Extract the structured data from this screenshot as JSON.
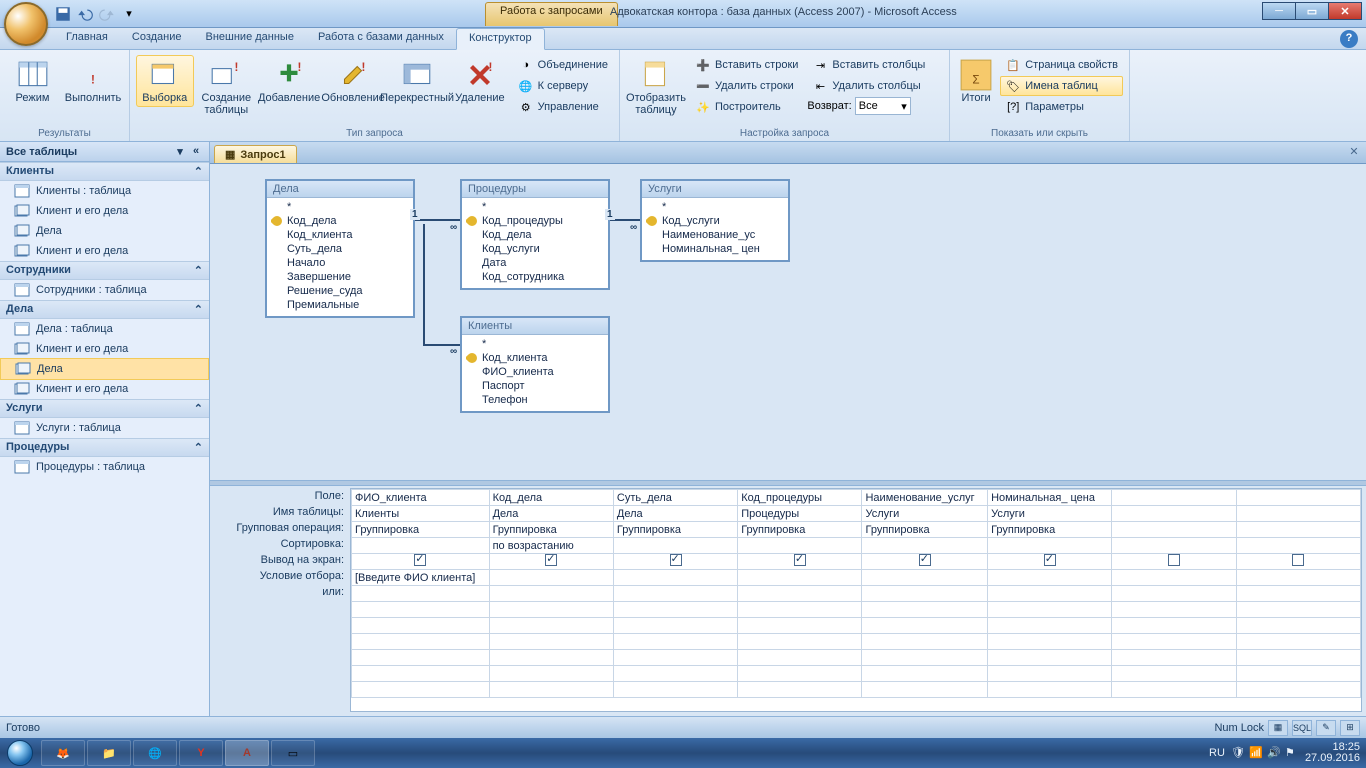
{
  "title": {
    "context": "Работа с запросами",
    "main": "Адвокатская контора : база данных (Access 2007) - Microsoft Access"
  },
  "tabs": {
    "t1": "Главная",
    "t2": "Создание",
    "t3": "Внешние данные",
    "t4": "Работа с базами данных",
    "t5": "Конструктор"
  },
  "ribbon": {
    "g1": "Результаты",
    "g2": "Тип запроса",
    "g3": "Настройка запроса",
    "g4": "Показать или скрыть",
    "rezhim": "Режим",
    "vypolnit": "Выполнить",
    "vyborka": "Выборка",
    "sozdanie": "Создание\nтаблицы",
    "dobavlenie": "Добавление",
    "obnovlenie": "Обновление",
    "perekrest": "Перекрестный",
    "udalenie": "Удаление",
    "obed": "Объединение",
    "kserv": "К серверу",
    "uprav": "Управление",
    "otobrazit": "Отобразить\nтаблицу",
    "vststr": "Вставить строки",
    "udstr": "Удалить строки",
    "postroit": "Построитель",
    "vststol": "Вставить столбцы",
    "udstol": "Удалить столбцы",
    "vozvrat": "Возврат:",
    "vozvratval": "Все",
    "itogi": "Итоги",
    "strsvo": "Страница свойств",
    "imtab": "Имена таблиц",
    "param": "Параметры"
  },
  "nav": {
    "header": "Все таблицы",
    "groups": [
      {
        "title": "Клиенты",
        "items": [
          "Клиенты : таблица",
          "Клиент и его дела",
          "Дела",
          "Клиент и его дела"
        ]
      },
      {
        "title": "Сотрудники",
        "items": [
          "Сотрудники : таблица"
        ]
      },
      {
        "title": "Дела",
        "items": [
          "Дела : таблица",
          "Клиент и его дела",
          "Дела",
          "Клиент и его дела"
        ],
        "selected": 2
      },
      {
        "title": "Услуги",
        "items": [
          "Услуги : таблица"
        ]
      },
      {
        "title": "Процедуры",
        "items": [
          "Процедуры : таблица"
        ]
      }
    ]
  },
  "doc": {
    "tab": "Запрос1"
  },
  "tables": {
    "dela": {
      "title": "Дела",
      "fields": [
        "*",
        "Код_дела",
        "Код_клиента",
        "Суть_дела",
        "Начало",
        "Завершение",
        "Решение_суда",
        "Премиальные"
      ],
      "key": 1
    },
    "proc": {
      "title": "Процедуры",
      "fields": [
        "*",
        "Код_процедуры",
        "Код_дела",
        "Код_услуги",
        "Дата",
        "Код_сотрудника"
      ],
      "key": 1
    },
    "usl": {
      "title": "Услуги",
      "fields": [
        "*",
        "Код_услуги",
        "Наименование_ус",
        "Номинальная_ цен"
      ],
      "key": 1
    },
    "kli": {
      "title": "Клиенты",
      "fields": [
        "*",
        "Код_клиента",
        "ФИО_клиента",
        "Паспорт",
        "Телефон"
      ],
      "key": 1
    }
  },
  "qbe": {
    "labels": [
      "Поле:",
      "Имя таблицы:",
      "Групповая операция:",
      "Сортировка:",
      "Вывод на экран:",
      "Условие отбора:",
      "или:"
    ],
    "cols": [
      {
        "field": "ФИО_клиента",
        "table": "Клиенты",
        "group": "Группировка",
        "sort": "",
        "show": true,
        "crit": "[Введите ФИО клиента]"
      },
      {
        "field": "Код_дела",
        "table": "Дела",
        "group": "Группировка",
        "sort": "по возрастанию",
        "show": true,
        "crit": ""
      },
      {
        "field": "Суть_дела",
        "table": "Дела",
        "group": "Группировка",
        "sort": "",
        "show": true,
        "crit": ""
      },
      {
        "field": "Код_процедуры",
        "table": "Процедуры",
        "group": "Группировка",
        "sort": "",
        "show": true,
        "crit": ""
      },
      {
        "field": "Наименование_услуг",
        "table": "Услуги",
        "group": "Группировка",
        "sort": "",
        "show": true,
        "crit": ""
      },
      {
        "field": "Номинальная_ цена",
        "table": "Услуги",
        "group": "Группировка",
        "sort": "",
        "show": true,
        "crit": ""
      },
      {
        "field": "",
        "table": "",
        "group": "",
        "sort": "",
        "show": false,
        "crit": ""
      },
      {
        "field": "",
        "table": "",
        "group": "",
        "sort": "",
        "show": false,
        "crit": ""
      }
    ]
  },
  "status": {
    "left": "Готово",
    "numlock": "Num Lock"
  },
  "tray": {
    "lang": "RU",
    "time": "18:25",
    "date": "27.09.2016"
  }
}
